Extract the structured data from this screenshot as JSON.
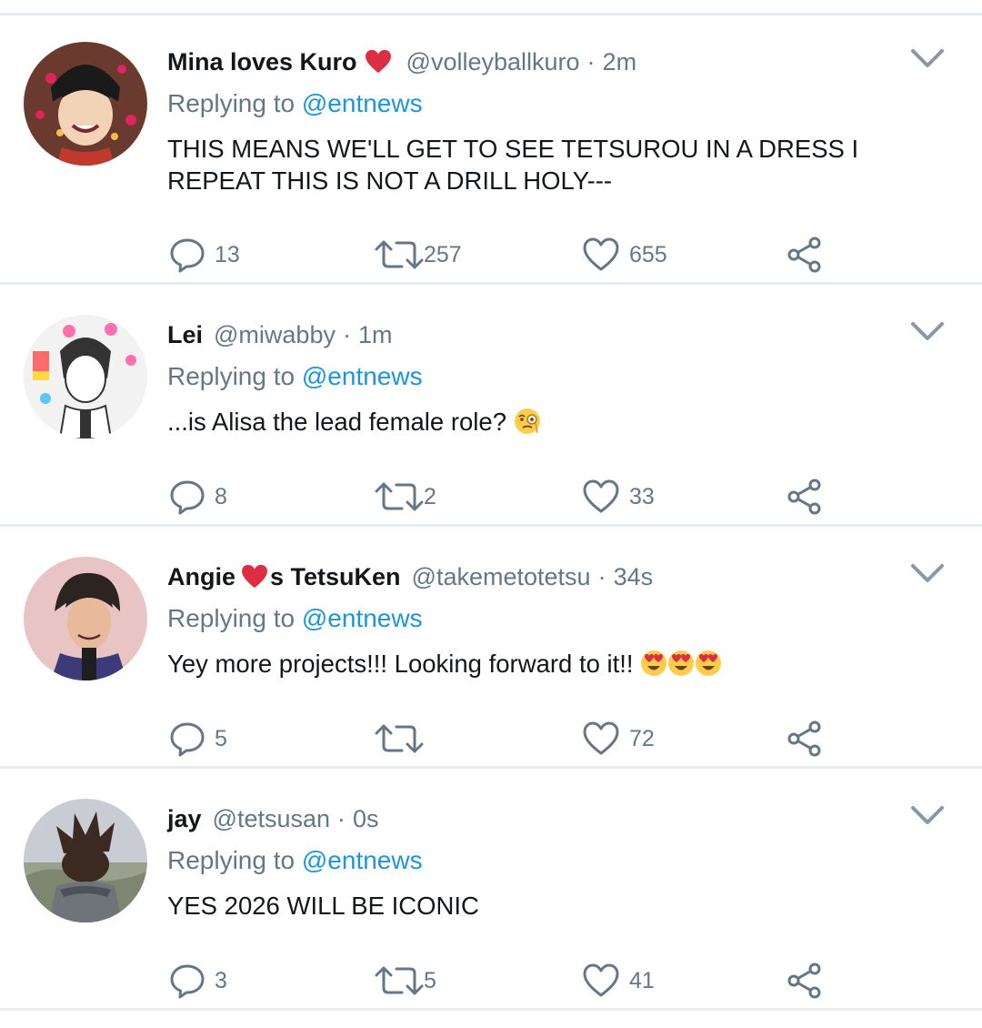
{
  "colors": {
    "accent": "#1b95e0",
    "muted": "#657786",
    "text": "#14171a",
    "divider": "#e6ecf0",
    "heart": "#e0245e"
  },
  "replying_prefix": "Replying to",
  "tweets": [
    {
      "name": "Mina loves Kuro",
      "name_emoji": "red-heart",
      "name_suffix": "",
      "handle": "@volleyballkuro",
      "time": "2m",
      "reply_to": "@entnews",
      "text": "THIS MEANS WE'LL GET TO SEE TETSUROU IN A DRESS I REPEAT THIS IS NOT A DRILL HOLY---",
      "emojis": [],
      "replies": "13",
      "retweets": "257",
      "likes": "655"
    },
    {
      "name": "Lei",
      "name_suffix": "",
      "handle": "@miwabby",
      "time": "1m",
      "reply_to": "@entnews",
      "text": "...is Alisa the lead female role?",
      "emojis": [
        "face-with-monocle"
      ],
      "replies": "8",
      "retweets": "2",
      "likes": "33"
    },
    {
      "name": "Angie",
      "name_emoji": "red-heart",
      "name_suffix": "s TetsuKen",
      "handle": "@takemetotetsu",
      "time": "34s",
      "reply_to": "@entnews",
      "text": "Yey more projects!!! Looking forward to it!!",
      "emojis": [
        "heart-eyes",
        "heart-eyes",
        "heart-eyes"
      ],
      "replies": "5",
      "retweets": "",
      "likes": "72"
    },
    {
      "name": "jay",
      "name_suffix": "",
      "handle": "@tetsusan",
      "time": "0s",
      "reply_to": "@entnews",
      "text": "YES 2026 WILL BE ICONIC",
      "emojis": [],
      "replies": "3",
      "retweets": "5",
      "likes": "41"
    }
  ]
}
